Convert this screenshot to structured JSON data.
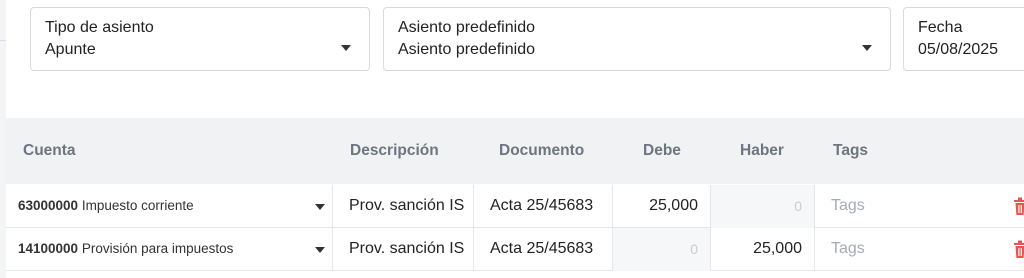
{
  "form": {
    "tipo_asiento": {
      "label": "Tipo de asiento",
      "value": "Apunte"
    },
    "asiento_predefinido": {
      "label": "Asiento predefinido",
      "value": "Asiento predefinido"
    },
    "fecha": {
      "label": "Fecha",
      "value": "05/08/2025"
    }
  },
  "table": {
    "headers": [
      "Cuenta",
      "Descripción",
      "Documento",
      "Debe",
      "Haber",
      "Tags"
    ],
    "rows": [
      {
        "account_code": "63000000",
        "account_name": "Impuesto corriente",
        "descripcion": "Prov. sanción IS",
        "documento": "Acta 25/45683",
        "debe": "25,000",
        "haber": "0",
        "tags": "Tags"
      },
      {
        "account_code": "14100000",
        "account_name": "Provisión para impuestos",
        "descripcion": "Prov. sanción IS",
        "documento": "Acta 25/45683",
        "debe": "0",
        "haber": "25,000",
        "tags": "Tags"
      }
    ]
  },
  "colors": {
    "delete_icon": "#e8544f",
    "header_bg": "#f1f2f4",
    "header_text": "#6e7580",
    "placeholder": "#a6abb3"
  },
  "icons": {
    "dropdown": "chevron-down-icon",
    "delete": "trash-icon"
  }
}
